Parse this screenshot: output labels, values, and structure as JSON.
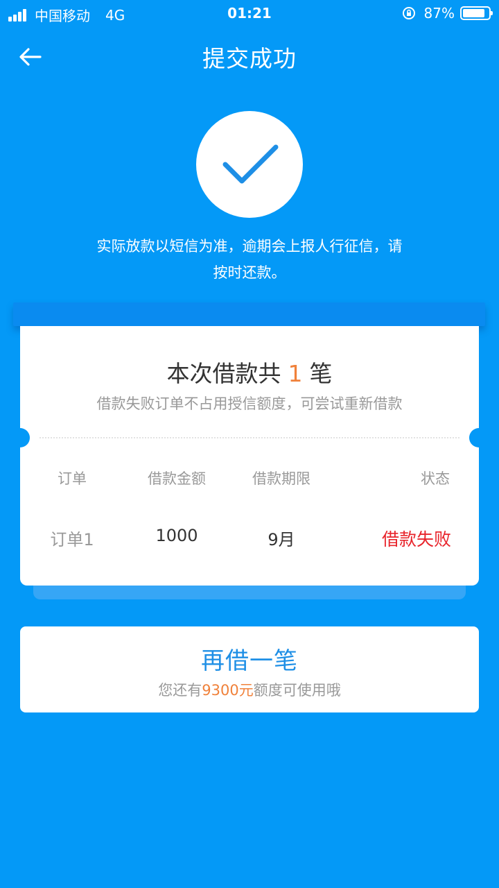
{
  "status_bar": {
    "carrier": "中国移动",
    "network": "4G",
    "time": "01:21",
    "battery_percent_label": "87%",
    "battery_level": 0.87
  },
  "nav": {
    "title": "提交成功",
    "back_icon": "arrow-left-icon"
  },
  "success": {
    "icon": "checkmark-icon",
    "notice_line1": "实际放款以短信为准，逾期会上报人行征信，请",
    "notice_line2": "按时还款。"
  },
  "receipt": {
    "title_prefix": "本次借款共",
    "count": "1",
    "title_suffix": "笔",
    "subtitle": "借款失败订单不占用授信额度，可尝试重新借款",
    "columns": {
      "order": "订单",
      "amount": "借款金额",
      "term": "借款期限",
      "status": "状态"
    },
    "rows": [
      {
        "order": "订单1",
        "amount": "1000",
        "term": "9月",
        "status": "借款失败"
      }
    ]
  },
  "borrow_again": {
    "title": "再借一笔",
    "sub_prefix": "您还有",
    "sub_amount": "9300元",
    "sub_suffix": "额度可使用哦"
  },
  "colors": {
    "background": "#0499F7",
    "accent_orange": "#F0813A",
    "status_fail_red": "#E8242B",
    "button_text_blue": "#1E8FE6"
  }
}
